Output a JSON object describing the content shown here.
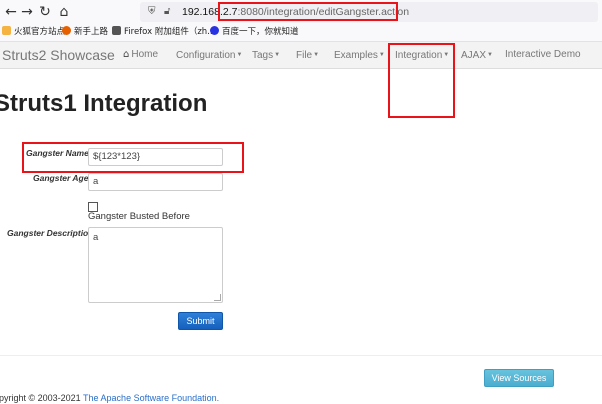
{
  "browser": {
    "url_host": "192.168.2.7",
    "url_path": ":8080/integration/editGangster.action",
    "bookmarks": [
      {
        "label": "火狐官方站点",
        "color": "#e66000"
      },
      {
        "label": "新手上路",
        "color": "#e66000"
      },
      {
        "label": "Firefox 附加组件（zh...",
        "color": "#444"
      },
      {
        "label": "百度一下，你就知道",
        "color": "#2932e1"
      }
    ]
  },
  "navbar": {
    "brand": "Struts2 Showcase",
    "items": [
      {
        "label": "Home",
        "has_caret": false
      },
      {
        "label": "Configuration",
        "has_caret": true
      },
      {
        "label": "Tags",
        "has_caret": true
      },
      {
        "label": "File",
        "has_caret": true
      },
      {
        "label": "Examples",
        "has_caret": true
      },
      {
        "label": "Integration",
        "has_caret": true
      },
      {
        "label": "AJAX",
        "has_caret": true
      },
      {
        "label": "Interactive Demo",
        "has_caret": false
      }
    ]
  },
  "page": {
    "title": "Struts1 Integration"
  },
  "form": {
    "name_label": "Gangster Name:",
    "name_value": "${123*123}",
    "age_label": "Gangster Age:",
    "age_value": "a",
    "busted_label": "Gangster Busted Before",
    "busted_checked": false,
    "description_label": "Gangster Description:",
    "description_value": "a",
    "submit_label": "Submit"
  },
  "footer": {
    "view_sources_label": "View Sources",
    "copyright_prefix": "opyright © 2003-2021 ",
    "copyright_link": "The Apache Software Foundation."
  },
  "colors": {
    "highlight": "#e8141a",
    "primary_button": "#1a66c4",
    "info_button": "#5bc0de",
    "link": "#2a6fc9"
  }
}
